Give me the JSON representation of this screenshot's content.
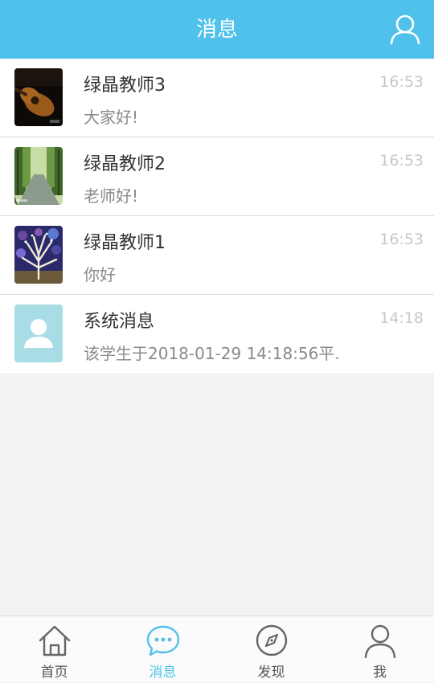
{
  "header": {
    "title": "消息",
    "profile_icon": "user-icon"
  },
  "colors": {
    "accent": "#4fc1ea",
    "background": "#f3f3f3",
    "time_text": "#c8c8c8"
  },
  "messages": [
    {
      "name": "绿晶教师3",
      "preview": "大家好!",
      "time": "16:53",
      "avatar": "guitar-photo"
    },
    {
      "name": "绿晶教师2",
      "preview": "老师好!",
      "time": "16:53",
      "avatar": "forest-road-photo"
    },
    {
      "name": "绿晶教师1",
      "preview": "你好",
      "time": "16:53",
      "avatar": "tree-painting-photo"
    },
    {
      "name": "系统消息",
      "preview": "该学生于2018-01-29 14:18:56平...",
      "time": "14:18",
      "avatar": "default-user-avatar"
    }
  ],
  "tabbar": {
    "active": "消息",
    "items": [
      {
        "label": "首页",
        "icon": "home-icon"
      },
      {
        "label": "消息",
        "icon": "chat-bubble-icon"
      },
      {
        "label": "发现",
        "icon": "compass-icon"
      },
      {
        "label": "我",
        "icon": "user-icon"
      }
    ]
  }
}
